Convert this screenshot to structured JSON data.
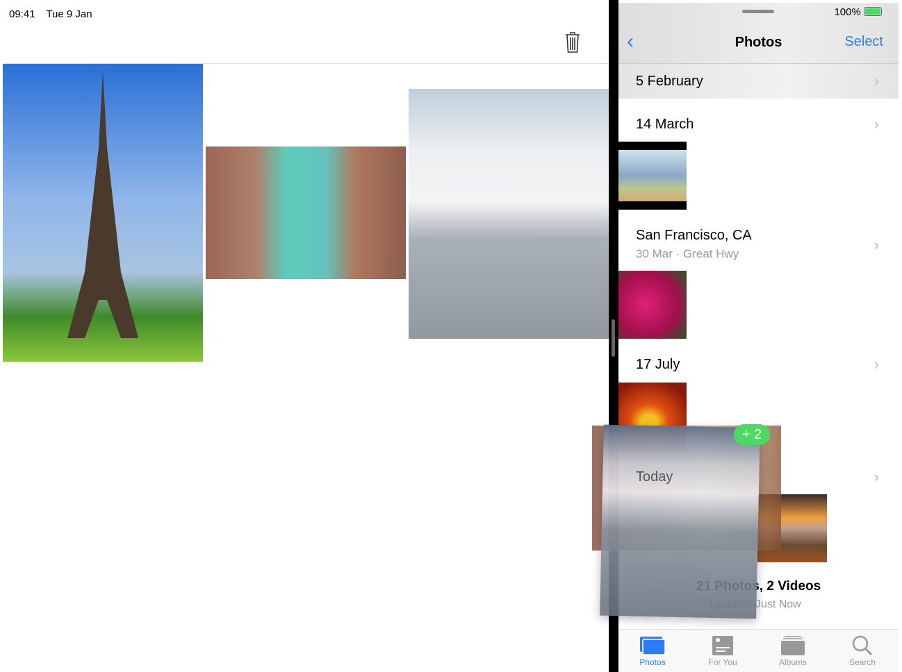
{
  "left_pane": {
    "status": {
      "time": "09:41",
      "date": "Tue 9 Jan"
    },
    "toolbar": {
      "trash_icon": "trash-icon"
    },
    "photos": [
      "eiffel-tower",
      "venice-canal",
      "iceberg"
    ]
  },
  "right_pane": {
    "status": {
      "battery": "100%"
    },
    "nav": {
      "back_icon": "chevron-left-icon",
      "title": "Photos",
      "select_label": "Select"
    },
    "sections": [
      {
        "title": "5 February"
      },
      {
        "title": "14 March"
      },
      {
        "title": "San Francisco, CA",
        "subtitle": "30 Mar  ·  Great Hwy"
      },
      {
        "title": "17 July"
      },
      {
        "title": "Today"
      }
    ],
    "summary": {
      "count": "21 Photos, 2 Videos",
      "updated": "Updated Just Now"
    },
    "tabs": [
      {
        "label": "Photos",
        "active": true
      },
      {
        "label": "For You"
      },
      {
        "label": "Albums"
      },
      {
        "label": "Search"
      }
    ],
    "accent": "#2f7cf6"
  },
  "drag": {
    "badge": "+ 2",
    "badge_color": "#4cd964"
  }
}
